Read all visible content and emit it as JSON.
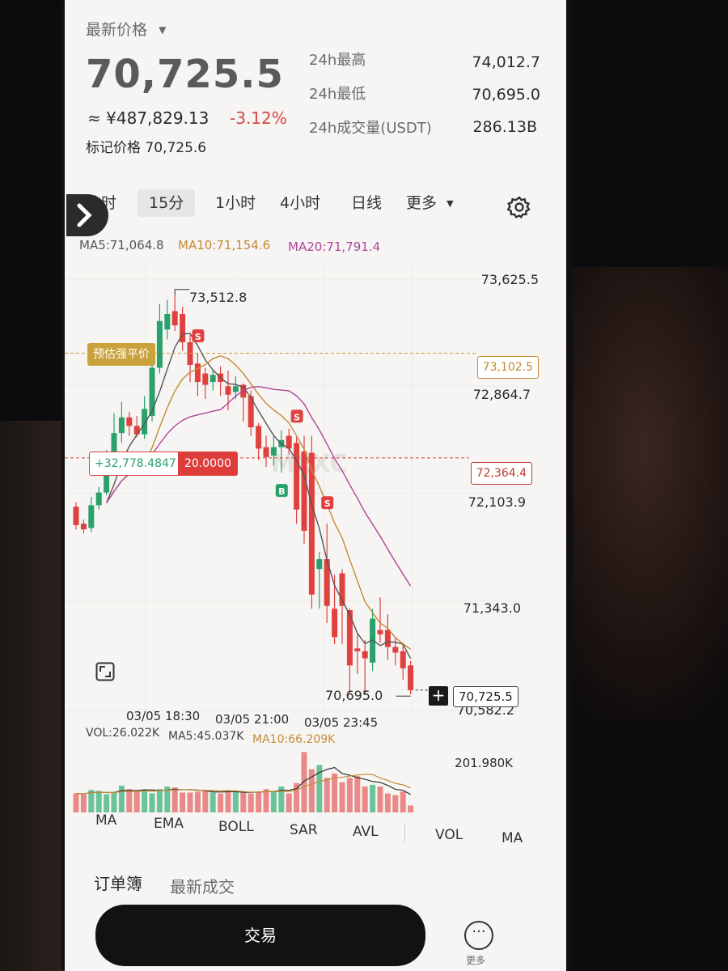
{
  "header": {
    "price_type_label": "最新价格",
    "last_price": "70,725.5",
    "cny_price": "≈ ¥487,829.13",
    "change_pct": "-3.12%",
    "mark_price_label": "标记价格",
    "mark_price": "70,725.6"
  },
  "stats": [
    {
      "label": "24h最高",
      "value": "74,012.7"
    },
    {
      "label": "24h最低",
      "value": "70,695.0"
    },
    {
      "label": "24h成交量(USDT)",
      "value": "286.13B"
    }
  ],
  "intervals": {
    "items": [
      "分时",
      "15分",
      "1小时",
      "4小时",
      "日线",
      "更多"
    ],
    "active": "15分"
  },
  "ma_legend": {
    "ma5": "MA5:71,064.8",
    "ma10": "MA10:71,154.6",
    "ma20": "MA20:71,791.4"
  },
  "chart": {
    "price_axis": [
      "73,625.5",
      "72,864.7",
      "72,103.9",
      "71,343.0",
      "70,582.2"
    ],
    "high_marker": "73,512.8",
    "low_marker": "70,695.0",
    "liq_label": "预估强平价",
    "liq_price": "73,102.5",
    "position_pnl": "+32,778.4847",
    "position_leverage": "20.0000",
    "entry_price": "72,364.4",
    "current_price": "70,725.5",
    "time_labels": [
      "03/05 18:30",
      "03/05 21:00",
      "03/05 23:45"
    ],
    "watermark": "MEXC",
    "colors": {
      "up": "#2aa16b",
      "down": "#e0413f",
      "ma5": "#555555",
      "ma10": "#c58a35",
      "ma20": "#b0449a"
    }
  },
  "volume": {
    "vol": "VOL:26.022K",
    "ma5": "MA5:45.037K",
    "ma10": "MA10:66.209K",
    "axis_max": "201.980K"
  },
  "indicators": [
    "MA",
    "EMA",
    "BOLL",
    "SAR",
    "AVL",
    "VOL",
    "MA"
  ],
  "bottom_tabs": [
    "订单簿",
    "最新成交"
  ],
  "trade_button": "交易",
  "more_label": "更多",
  "chart_data": {
    "type": "candlestick",
    "candles": [
      {
        "o": 72020,
        "c": 71890,
        "h": 72050,
        "l": 71860
      },
      {
        "o": 71900,
        "c": 71860,
        "h": 71930,
        "l": 71830
      },
      {
        "o": 71870,
        "c": 72030,
        "h": 72090,
        "l": 71840
      },
      {
        "o": 72030,
        "c": 72120,
        "h": 72160,
        "l": 72000
      },
      {
        "o": 72120,
        "c": 72330,
        "h": 72420,
        "l": 72100
      },
      {
        "o": 72330,
        "c": 72540,
        "h": 72680,
        "l": 72290
      },
      {
        "o": 72540,
        "c": 72650,
        "h": 72760,
        "l": 72470
      },
      {
        "o": 72650,
        "c": 72590,
        "h": 72690,
        "l": 72520
      },
      {
        "o": 72590,
        "c": 72530,
        "h": 72660,
        "l": 72510
      },
      {
        "o": 72530,
        "c": 72710,
        "h": 72800,
        "l": 72500
      },
      {
        "o": 72660,
        "c": 73000,
        "h": 73150,
        "l": 72620
      },
      {
        "o": 73000,
        "c": 73330,
        "h": 73450,
        "l": 72960
      },
      {
        "o": 73270,
        "c": 73380,
        "h": 73480,
        "l": 73200
      },
      {
        "o": 73400,
        "c": 73300,
        "h": 73512.8,
        "l": 73260
      },
      {
        "o": 73380,
        "c": 73180,
        "h": 73430,
        "l": 73120
      },
      {
        "o": 73180,
        "c": 73020,
        "h": 73230,
        "l": 72900
      },
      {
        "o": 73030,
        "c": 72900,
        "h": 73100,
        "l": 72800
      },
      {
        "o": 72960,
        "c": 72880,
        "h": 73000,
        "l": 72780
      },
      {
        "o": 72900,
        "c": 72950,
        "h": 72980,
        "l": 72840
      },
      {
        "o": 72960,
        "c": 72900,
        "h": 73010,
        "l": 72800
      },
      {
        "o": 72870,
        "c": 72810,
        "h": 72980,
        "l": 72700
      },
      {
        "o": 72830,
        "c": 72870,
        "h": 72940,
        "l": 72780
      },
      {
        "o": 72880,
        "c": 72790,
        "h": 72890,
        "l": 72620
      },
      {
        "o": 72800,
        "c": 72580,
        "h": 72840,
        "l": 72520
      },
      {
        "o": 72590,
        "c": 72430,
        "h": 72610,
        "l": 72350
      },
      {
        "o": 72440,
        "c": 72370,
        "h": 72520,
        "l": 72300
      },
      {
        "o": 72380,
        "c": 72440,
        "h": 72520,
        "l": 72310
      },
      {
        "o": 72440,
        "c": 72490,
        "h": 72560,
        "l": 72260
      },
      {
        "o": 72520,
        "c": 72430,
        "h": 72570,
        "l": 72390
      },
      {
        "o": 72470,
        "c": 72000,
        "h": 72510,
        "l": 71900
      },
      {
        "o": 72410,
        "c": 71850,
        "h": 72520,
        "l": 71760
      },
      {
        "o": 72400,
        "c": 71400,
        "h": 72520,
        "l": 71300
      },
      {
        "o": 71580,
        "c": 71650,
        "h": 71700,
        "l": 71300
      },
      {
        "o": 71650,
        "c": 71320,
        "h": 71900,
        "l": 71200
      },
      {
        "o": 71300,
        "c": 71100,
        "h": 71540,
        "l": 71050
      },
      {
        "o": 71550,
        "c": 71320,
        "h": 71580,
        "l": 71050
      },
      {
        "o": 71290,
        "c": 70900,
        "h": 71300,
        "l": 70700
      },
      {
        "o": 71020,
        "c": 71000,
        "h": 71120,
        "l": 70840
      },
      {
        "o": 71000,
        "c": 70950,
        "h": 71080,
        "l": 70700
      },
      {
        "o": 70920,
        "c": 71230,
        "h": 71300,
        "l": 70860
      },
      {
        "o": 71150,
        "c": 71120,
        "h": 71380,
        "l": 71060
      },
      {
        "o": 71150,
        "c": 71030,
        "h": 71260,
        "l": 70940
      },
      {
        "o": 71030,
        "c": 70990,
        "h": 71100,
        "l": 70900
      },
      {
        "o": 71000,
        "c": 70880,
        "h": 71060,
        "l": 70800
      },
      {
        "o": 70900,
        "c": 70725.5,
        "h": 70930,
        "l": 70695
      }
    ],
    "volumes": [
      22,
      21,
      26,
      25,
      21,
      23,
      31,
      27,
      24,
      26,
      22,
      27,
      30,
      29,
      23,
      23,
      24,
      26,
      23,
      22,
      25,
      24,
      23,
      22,
      24,
      27,
      25,
      30,
      22,
      34,
      70,
      50,
      55,
      40,
      45,
      35,
      40,
      42,
      30,
      32,
      30,
      22,
      20,
      24,
      8
    ]
  }
}
